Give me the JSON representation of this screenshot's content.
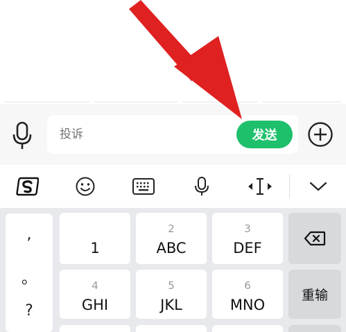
{
  "input_bar": {
    "placeholder": "投诉",
    "send_label": "发送"
  },
  "toolbar": {
    "icons": [
      "sogou-logo-icon",
      "emoji-icon",
      "keyboard-icon",
      "microphone-icon",
      "cursor-move-icon",
      "collapse-chevron-icon"
    ]
  },
  "keyboard": {
    "punctuation": [
      ",",
      "。",
      "?"
    ],
    "keys": [
      {
        "num": "",
        "letters": "1"
      },
      {
        "num": "2",
        "letters": "ABC"
      },
      {
        "num": "3",
        "letters": "DEF"
      },
      {
        "num": "4",
        "letters": "GHI"
      },
      {
        "num": "5",
        "letters": "JKL"
      },
      {
        "num": "6",
        "letters": "MNO"
      }
    ],
    "retype_label": "重输"
  },
  "colors": {
    "send_button": "#1ec06b",
    "annotation_arrow": "#e02121",
    "keyboard_bg": "#e8e9ec"
  }
}
